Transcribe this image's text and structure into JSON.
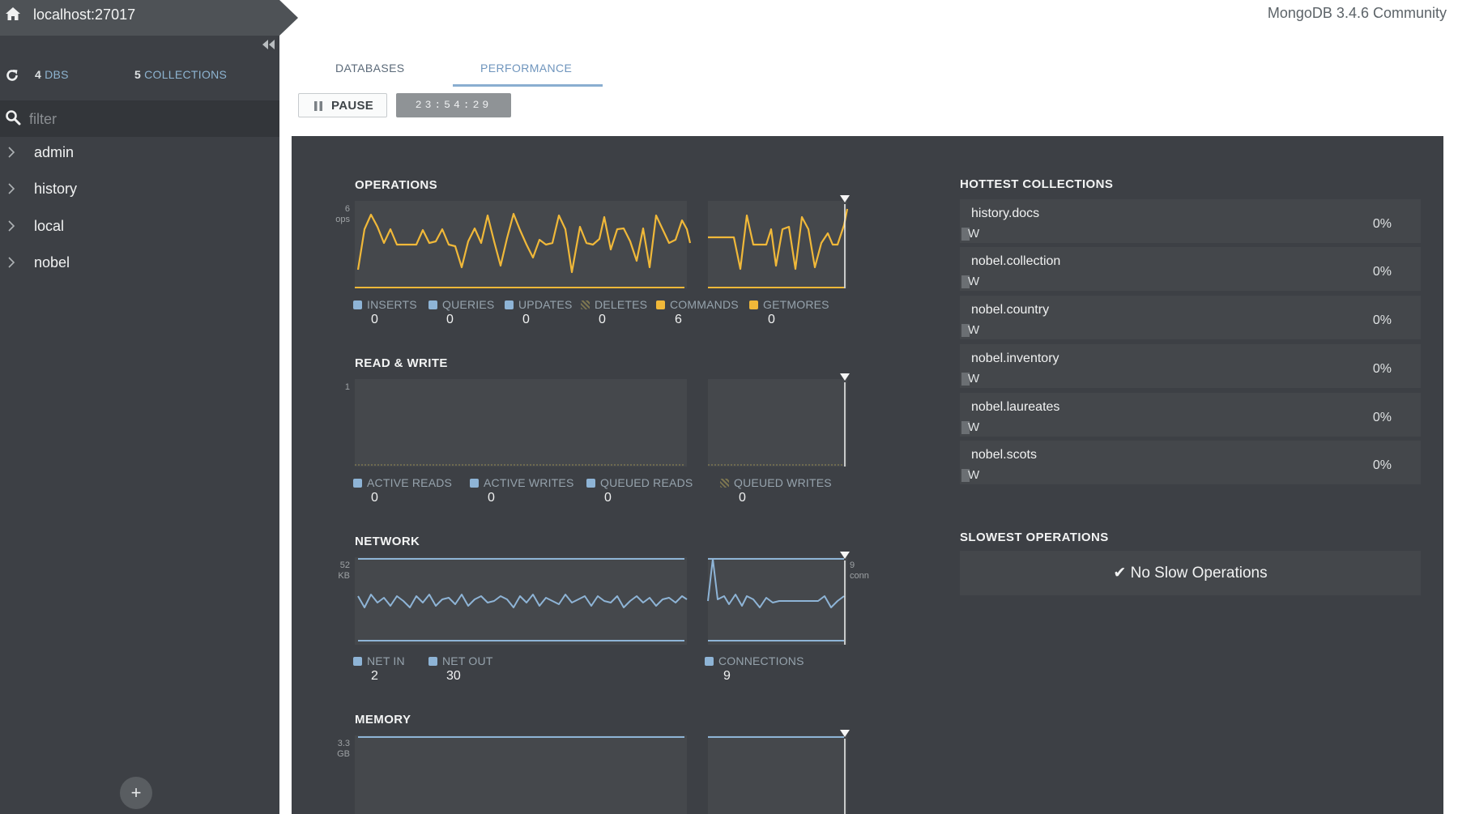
{
  "app": {
    "host": "localhost:27017",
    "version": "MongoDB 3.4.6 Community"
  },
  "sidebar": {
    "stats": {
      "dbs_count": "4",
      "dbs_label": "DBS",
      "collections_count": "5",
      "collections_label": "COLLECTIONS"
    },
    "filter_placeholder": "filter",
    "databases": [
      "admin",
      "history",
      "local",
      "nobel"
    ],
    "icons": [
      "home-icon",
      "collapse-sidebar-icon",
      "refresh-icon",
      "search-icon",
      "chevron-right-icon",
      "plus-icon"
    ]
  },
  "tabs": [
    {
      "label": "DATABASES",
      "active": false
    },
    {
      "label": "PERFORMANCE",
      "active": true
    }
  ],
  "toolbar": {
    "pause_label": "PAUSE",
    "timer": "23:54:29"
  },
  "colors": {
    "ops": "#f0b839",
    "network": "#8eb4d6",
    "sidebar": "#3d4045",
    "panel": "#3d4045"
  },
  "charts": {
    "operations": {
      "title": "OPERATIONS",
      "y_max_label": "6",
      "y_unit": "ops",
      "legend": [
        {
          "label": "INSERTS",
          "value": "0",
          "color": "#8eb4d6",
          "style": "solid"
        },
        {
          "label": "QUERIES",
          "value": "0",
          "color": "#8eb4d6",
          "style": "solid"
        },
        {
          "label": "UPDATES",
          "value": "0",
          "color": "#8eb4d6",
          "style": "solid"
        },
        {
          "label": "DELETES",
          "value": "0",
          "color": "#7d7650",
          "style": "hatched"
        },
        {
          "label": "COMMANDS",
          "value": "6",
          "color": "#f0b839",
          "style": "solid"
        },
        {
          "label": "GETMORES",
          "value": "0",
          "color": "#f0b839",
          "style": "solid"
        }
      ]
    },
    "read_write": {
      "title": "READ & WRITE",
      "y_max_label": "1",
      "legend": [
        {
          "label": "ACTIVE READS",
          "value": "0",
          "color": "#8eb4d6",
          "style": "solid"
        },
        {
          "label": "ACTIVE WRITES",
          "value": "0",
          "color": "#8eb4d6",
          "style": "solid"
        },
        {
          "label": "QUEUED READS",
          "value": "0",
          "color": "#8eb4d6",
          "style": "solid"
        },
        {
          "label": "QUEUED WRITES",
          "value": "0",
          "color": "#7d7650",
          "style": "hatched"
        }
      ]
    },
    "network": {
      "title": "NETWORK",
      "y_max_label": "52",
      "y_unit": "KB",
      "y2_max_label": "9",
      "y2_unit": "conn",
      "legend": [
        {
          "label": "NET IN",
          "value": "2",
          "color": "#8eb4d6",
          "style": "solid"
        },
        {
          "label": "NET OUT",
          "value": "30",
          "color": "#8eb4d6",
          "style": "solid"
        },
        {
          "label": "CONNECTIONS",
          "value": "9",
          "color": "#8eb4d6",
          "style": "solid"
        }
      ]
    },
    "memory": {
      "title": "MEMORY",
      "y_max_label": "3.3",
      "y_unit": "GB"
    }
  },
  "hottest_collections": {
    "title": "HOTTEST COLLECTIONS",
    "rows": [
      {
        "name": "history.docs",
        "percent": "0%",
        "rw": "W"
      },
      {
        "name": "nobel.collection",
        "percent": "0%",
        "rw": "W"
      },
      {
        "name": "nobel.country",
        "percent": "0%",
        "rw": "W"
      },
      {
        "name": "nobel.inventory",
        "percent": "0%",
        "rw": "W"
      },
      {
        "name": "nobel.laureates",
        "percent": "0%",
        "rw": "W"
      },
      {
        "name": "nobel.scots",
        "percent": "0%",
        "rw": "W"
      }
    ]
  },
  "slowest_operations": {
    "title": "SLOWEST OPERATIONS",
    "empty_text": "✔ No Slow Operations"
  }
}
